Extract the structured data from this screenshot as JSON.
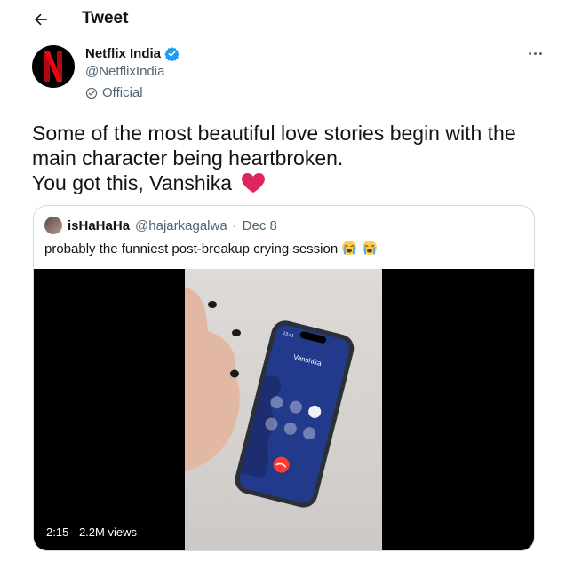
{
  "header": {
    "title": "Tweet"
  },
  "author": {
    "name": "Netflix India",
    "handle": "@NetflixIndia",
    "label": "Official",
    "avatar_letter": "N"
  },
  "tweet": {
    "lines": [
      "Some of the most beautiful love stories begin with the",
      "main character being heartbroken.",
      "You got this, Vanshika"
    ]
  },
  "quote": {
    "name": "isHaHaHa",
    "handle": "@hajarkagalwa",
    "separator": "·",
    "date": "Dec 8",
    "text": "probably the funniest post-breakup crying session",
    "video": {
      "duration": "2:15",
      "views": "2.2M views",
      "phone_contact": "Vanshika",
      "phone_time": "13:41"
    }
  },
  "colors": {
    "verified": "#1d9bf0",
    "netflix_red": "#e50914",
    "heart": "#e0245e",
    "secondary_text": "#536471"
  }
}
